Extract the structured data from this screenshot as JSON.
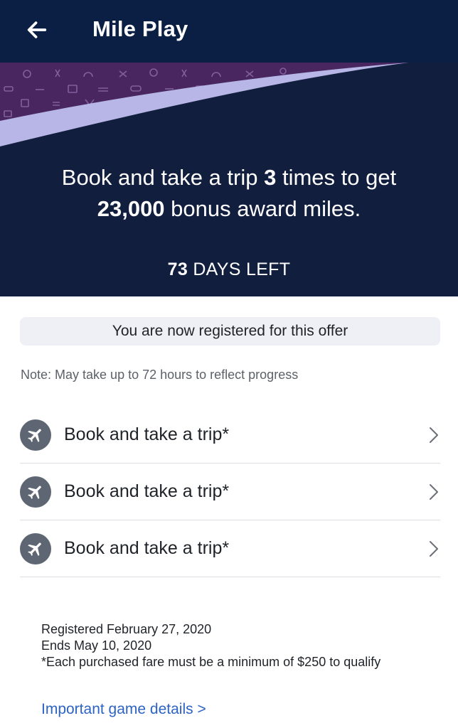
{
  "app_bar": {
    "title": "Mile Play",
    "back_icon": "arrow-left-icon",
    "background": "#0b1f45"
  },
  "hero": {
    "background": "#111e3d",
    "art_band_color": "#4a2660",
    "swoosh_color": "#b8b6e6",
    "headline": {
      "prefix": "Book and take a trip ",
      "trip_count": "3",
      "suffix": " times to get",
      "miles": "23,000",
      "miles_suffix": " bonus award miles."
    },
    "days_left": {
      "count": "73",
      "label": " DAYS LEFT"
    }
  },
  "registration": {
    "banner": "You are now registered for this offer",
    "note": "Note: May take up to 72 hours to reflect progress"
  },
  "trips": [
    {
      "label": "Book and take a trip*",
      "icon": "airplane-icon"
    },
    {
      "label": "Book and take a trip*",
      "icon": "airplane-icon"
    },
    {
      "label": "Book and take a trip*",
      "icon": "airplane-icon"
    }
  ],
  "details": {
    "registered": "Registered February 27, 2020",
    "ends": "Ends May 10, 2020",
    "fine_print": "*Each purchased fare must be a minimum of $250 to qualify"
  },
  "link": {
    "label": "Important game details >",
    "color": "#2c63c4"
  }
}
